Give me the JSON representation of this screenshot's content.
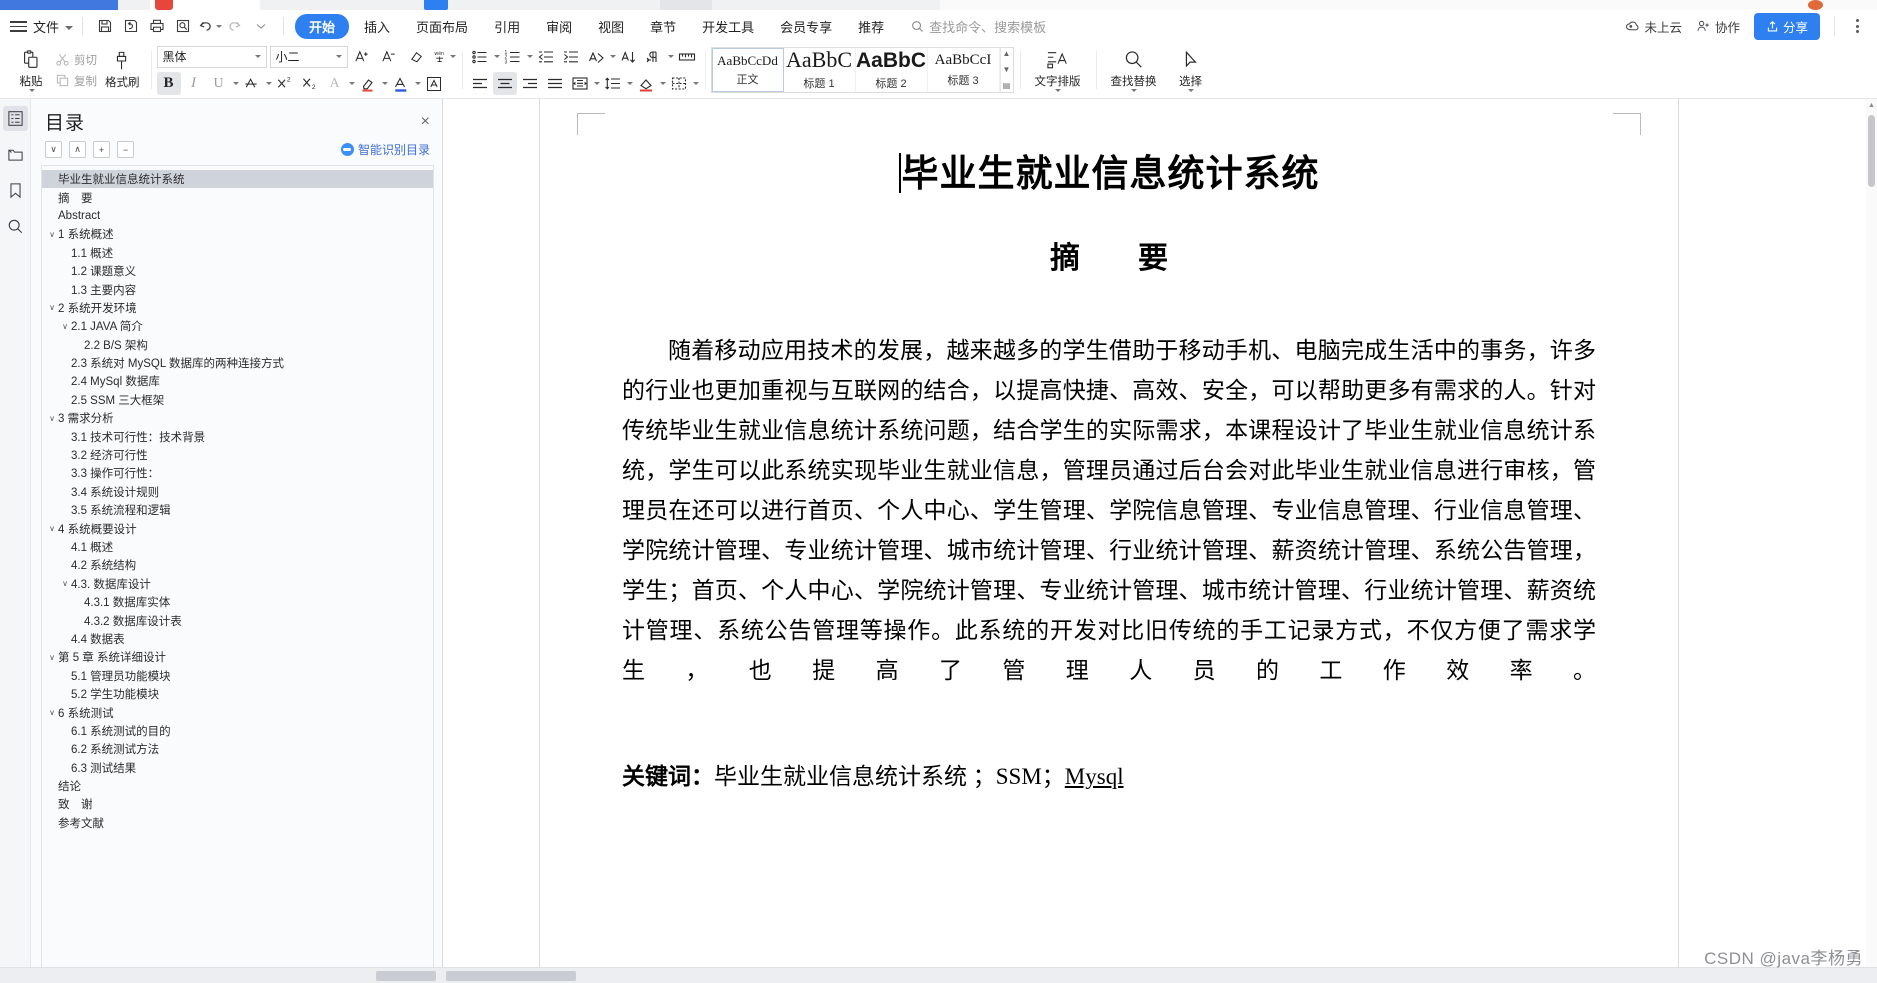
{
  "menubar": {
    "file_label": "文件",
    "quick_actions": [
      {
        "name": "save-icon",
        "label": "保存"
      },
      {
        "name": "save-as-icon",
        "label": "另存为"
      },
      {
        "name": "print-icon",
        "label": "打印"
      },
      {
        "name": "print-preview-icon",
        "label": "打印预览"
      },
      {
        "name": "undo-icon",
        "label": "撤销"
      },
      {
        "name": "redo-icon",
        "label": "恢复"
      },
      {
        "name": "customize-icon",
        "label": "自定义快速访问工具栏"
      }
    ],
    "tabs": [
      {
        "label": "开始",
        "active": true
      },
      {
        "label": "插入",
        "active": false
      },
      {
        "label": "页面布局",
        "active": false
      },
      {
        "label": "引用",
        "active": false
      },
      {
        "label": "审阅",
        "active": false
      },
      {
        "label": "视图",
        "active": false
      },
      {
        "label": "章节",
        "active": false
      },
      {
        "label": "开发工具",
        "active": false
      },
      {
        "label": "会员专享",
        "active": false
      },
      {
        "label": "推荐",
        "active": false
      }
    ],
    "search_placeholder": "查找命令、搜索模板",
    "cloud_status": "未上云",
    "collab_label": "协作",
    "share_label": "分享"
  },
  "ribbon": {
    "clipboard": {
      "paste_label": "粘贴",
      "cut_label": "剪切",
      "copy_label": "复制",
      "format_painter_label": "格式刷"
    },
    "font": {
      "family_value": "黑体",
      "size_value": "小二",
      "grow_label": "增大字号",
      "shrink_label": "减小字号",
      "clear_format_label": "清除格式",
      "pinyin_label": "拼音指南",
      "bold_label": "B",
      "italic_label": "I",
      "underline_label": "U",
      "strike_label": "A",
      "superscript_label": "X²",
      "subscript_label": "X₂",
      "char_shade_label": "A",
      "highlight_label": "A",
      "font_color_label": "A",
      "char_border_label": "A"
    },
    "paragraph": {
      "bullets_label": "项目符号",
      "numbering_label": "编号",
      "decrease_indent_label": "减少缩进",
      "increase_indent_label": "增加缩进",
      "bidi_label": "文字方向",
      "sort_label": "排序",
      "show_marks_label": "显示段落标记",
      "ruler_label": "标尺",
      "align_left_label": "左对齐",
      "align_center_label": "居中对齐",
      "align_right_label": "右对齐",
      "align_justify_label": "两端对齐",
      "distribute_label": "分散对齐",
      "line_spacing_label": "行距",
      "shading_label": "底纹",
      "borders_label": "边框"
    },
    "styles": [
      {
        "sample": "AaBbCcDd",
        "name": "正文",
        "size": "13px",
        "weight": "normal",
        "selected": true
      },
      {
        "sample": "AaBbC",
        "name": "标题 1",
        "size": "22px",
        "weight": "normal",
        "selected": false
      },
      {
        "sample": "AaBbC",
        "name": "标题 2",
        "size": "21px",
        "weight": "bold",
        "selected": false
      },
      {
        "sample": "AaBbCcI",
        "name": "标题 3",
        "size": "15px",
        "weight": "normal",
        "selected": false
      }
    ],
    "typeset_label": "文字排版",
    "find_replace_label": "查找替换",
    "select_label": "选择"
  },
  "left_rail": [
    {
      "icon": "outline-icon",
      "label": "目录",
      "active": true
    },
    {
      "icon": "chapter-nav-icon",
      "label": "章节导航",
      "active": false
    },
    {
      "icon": "bookmark-icon",
      "label": "书签",
      "active": false
    },
    {
      "icon": "search-icon",
      "label": "查找",
      "active": false
    }
  ],
  "toc_panel": {
    "title": "目录",
    "close_label": "×",
    "tools": [
      {
        "name": "next-heading-button",
        "glyph": "∨"
      },
      {
        "name": "prev-heading-button",
        "glyph": "∧"
      },
      {
        "name": "expand-all-button",
        "glyph": "+"
      },
      {
        "name": "collapse-all-button",
        "glyph": "−"
      }
    ],
    "ai_label": "智能识别目录",
    "items": [
      {
        "label": "毕业生就业信息统计系统",
        "indent": 0,
        "arrow": "",
        "selected": true
      },
      {
        "label": "摘　要",
        "indent": 0,
        "arrow": "",
        "selected": false
      },
      {
        "label": "Abstract",
        "indent": 0,
        "arrow": "",
        "selected": false
      },
      {
        "label": "1  系统概述",
        "indent": 0,
        "arrow": "∨",
        "selected": false
      },
      {
        "label": "1.1  概述",
        "indent": 1,
        "arrow": "",
        "selected": false
      },
      {
        "label": "1.2 课题意义",
        "indent": 1,
        "arrow": "",
        "selected": false
      },
      {
        "label": "1.3  主要内容",
        "indent": 1,
        "arrow": "",
        "selected": false
      },
      {
        "label": "2  系统开发环境",
        "indent": 0,
        "arrow": "∨",
        "selected": false
      },
      {
        "label": "2.1 JAVA 简介",
        "indent": 1,
        "arrow": "∨",
        "selected": false
      },
      {
        "label": "2.2 B/S 架构",
        "indent": 2,
        "arrow": "",
        "selected": false
      },
      {
        "label": "2.3 系统对 MySQL 数据库的两种连接方式",
        "indent": 1,
        "arrow": "",
        "selected": false
      },
      {
        "label": "2.4 MySql 数据库",
        "indent": 1,
        "arrow": "",
        "selected": false
      },
      {
        "label": "2.5 SSM 三大框架",
        "indent": 1,
        "arrow": "",
        "selected": false
      },
      {
        "label": "3  需求分析",
        "indent": 0,
        "arrow": "∨",
        "selected": false
      },
      {
        "label": "3.1 技术可行性：技术背景",
        "indent": 1,
        "arrow": "",
        "selected": false
      },
      {
        "label": "3.2 经济可行性",
        "indent": 1,
        "arrow": "",
        "selected": false
      },
      {
        "label": "3.3 操作可行性：",
        "indent": 1,
        "arrow": "",
        "selected": false
      },
      {
        "label": "3.4 系统设计规则",
        "indent": 1,
        "arrow": "",
        "selected": false
      },
      {
        "label": "3.5 系统流程和逻辑",
        "indent": 1,
        "arrow": "",
        "selected": false
      },
      {
        "label": "4 系统概要设计",
        "indent": 0,
        "arrow": "∨",
        "selected": false
      },
      {
        "label": "4.1  概述",
        "indent": 1,
        "arrow": "",
        "selected": false
      },
      {
        "label": "4.2  系统结构",
        "indent": 1,
        "arrow": "",
        "selected": false
      },
      {
        "label": "4.3. 数据库设计",
        "indent": 1,
        "arrow": "∨",
        "selected": false
      },
      {
        "label": "4.3.1  数据库实体",
        "indent": 2,
        "arrow": "",
        "selected": false
      },
      {
        "label": "4.3.2  数据库设计表",
        "indent": 2,
        "arrow": "",
        "selected": false
      },
      {
        "label": "4.4  数据表",
        "indent": 1,
        "arrow": "",
        "selected": false
      },
      {
        "label": "第 5 章  系统详细设计",
        "indent": 0,
        "arrow": "∨",
        "selected": false
      },
      {
        "label": "5.1 管理员功能模块",
        "indent": 1,
        "arrow": "",
        "selected": false
      },
      {
        "label": "5.2 学生功能模块",
        "indent": 1,
        "arrow": "",
        "selected": false
      },
      {
        "label": "6  系统测试",
        "indent": 0,
        "arrow": "∨",
        "selected": false
      },
      {
        "label": "6.1 系统测试的目的",
        "indent": 1,
        "arrow": "",
        "selected": false
      },
      {
        "label": "6.2 系统测试方法",
        "indent": 1,
        "arrow": "",
        "selected": false
      },
      {
        "label": "6.3  测试结果",
        "indent": 1,
        "arrow": "",
        "selected": false
      },
      {
        "label": "结论",
        "indent": 0,
        "arrow": "",
        "selected": false
      },
      {
        "label": "致　谢",
        "indent": 0,
        "arrow": "",
        "selected": false
      },
      {
        "label": "参考文献",
        "indent": 0,
        "arrow": "",
        "selected": false
      }
    ]
  },
  "document": {
    "title": "毕业生就业信息统计系统",
    "heading2": "摘　要",
    "paragraph": "随着移动应用技术的发展，越来越多的学生借助于移动手机、电脑完成生活中的事务，许多的行业也更加重视与互联网的结合，以提高快捷、高效、安全，可以帮助更多有需求的人。针对传统毕业生就业信息统计系统问题，结合学生的实际需求，本课程设计了毕业生就业信息统计系统，学生可以此系统实现毕业生就业信息，管理员通过后台会对此毕业生就业信息进行审核，管理员在还可以进行首页、个人中心、学生管理、学院信息管理、专业信息管理、行业信息管理、学院统计管理、专业统计管理、城市统计管理、行业统计管理、薪资统计管理、系统公告管理，学生；首页、个人中心、学院统计管理、专业统计管理、城市统计管理、行业统计管理、薪资统计管理、系统公告管理等操作。此系统的开发对比旧传统的手工记录方式，不仅方便了需求学生，也提高了管理人员的工作效率。",
    "keywords_label": "关键词：",
    "keywords_value": "毕业生就业信息统计系统 ；SSM；",
    "keywords_underlined": "Mysql"
  },
  "watermark": "CSDN @java李杨勇",
  "colors": {
    "accent": "#2e7ff0",
    "toc_selected": "#cfd4dc",
    "panel_bg": "#fafbfc",
    "rail_bg": "#f5f6f8",
    "ai_link": "#3e6fd6"
  }
}
